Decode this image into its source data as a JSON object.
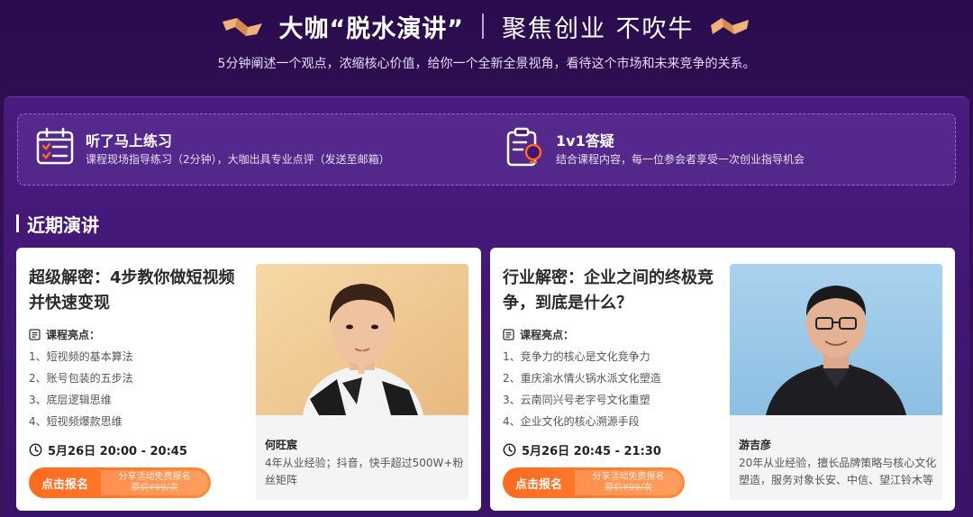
{
  "header": {
    "title_main": "大咖“脱水演讲”",
    "title_sub": "聚焦创业 不吹牛",
    "subtitle": "5分钟阐述一个观点，浓缩核心价值，给你一个全新全景视角，看待这个市场和未来竞争的关系。"
  },
  "features": [
    {
      "icon": "checklist-calendar-icon",
      "title": "听了马上练习",
      "desc": "课程现场指导练习（2分钟），大咖出具专业点评（发送至邮箱）"
    },
    {
      "icon": "clipboard-lightbulb-icon",
      "title": "1v1答疑",
      "desc": "结合课程内容，每一位参会者享受一次创业指导机会"
    }
  ],
  "section": {
    "title": "近期演讲"
  },
  "cards": [
    {
      "title": "超级解密：4步教你做短视频并快速变现",
      "highlights_label": "课程亮点：",
      "highlights": [
        "1、短视频的基本算法",
        "2、账号包装的五步法",
        "3、底层逻辑思维",
        "4、短视频爆款思维"
      ],
      "time": "5月26日 20:00 - 20:45",
      "cta": {
        "label": "点击报名",
        "share": "分享活动免费报名",
        "price": "原价¥99/次"
      },
      "speaker": {
        "name": "何旺宸",
        "desc": "4年从业经验；抖音，快手超过500W+粉丝矩阵"
      }
    },
    {
      "title": "行业解密：企业之间的终极竞争，到底是什么？",
      "highlights_label": "课程亮点：",
      "highlights": [
        "1、竞争力的核心是文化竞争力",
        "2、重庆渝水情火锅水派文化塑造",
        "3、云南同兴号老字号文化重塑",
        "4、企业文化的核心溯源手段"
      ],
      "time": "5月26日 20:45 - 21:30",
      "cta": {
        "label": "点击报名",
        "share": "分享活动免费报名",
        "price": "原价¥99/次"
      },
      "speaker": {
        "name": "游吉彦",
        "desc": "20年从业经验，擅长品牌策略与核心文化塑造，服务对象长安、中信、望江铃木等"
      }
    }
  ],
  "colors": {
    "accent_orange": "#ff6a1e",
    "bg_purple": "#2a0c4e",
    "deco_gold": "#f0b27a"
  }
}
